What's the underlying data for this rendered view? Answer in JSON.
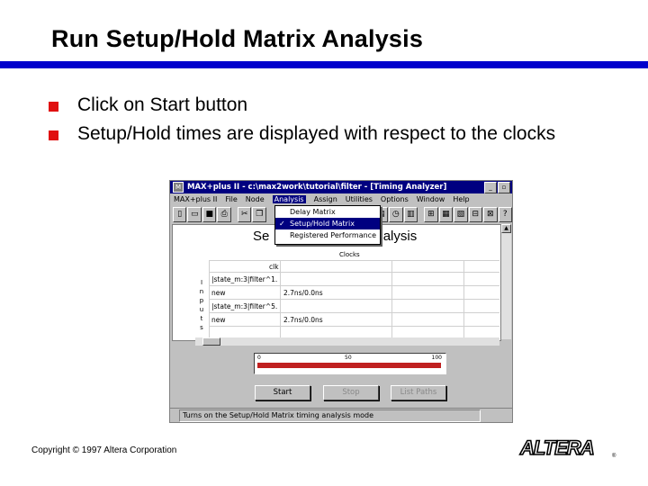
{
  "slide": {
    "title": "Run Setup/Hold Matrix Analysis",
    "bullets": [
      "Click on Start button",
      "Setup/Hold times are displayed with respect to the clocks"
    ],
    "copyright": "Copyright © 1997 Altera Corporation",
    "logo_text": "ALTERA"
  },
  "app": {
    "window_title": "MAX+plus II - c:\\max2work\\tutorial\\filter - [Timing Analyzer]",
    "menu": [
      "MAX+plus II",
      "File",
      "Node",
      "Analysis",
      "Assign",
      "Utilities",
      "Options",
      "Window",
      "Help"
    ],
    "active_menu": "Analysis",
    "analysis_menu": [
      {
        "label": "Delay Matrix",
        "checked": false
      },
      {
        "label": "Setup/Hold Matrix",
        "checked": true
      },
      {
        "label": "Registered Performance",
        "checked": false
      }
    ],
    "heading": "Setup/Hold Matrix Analysis",
    "heading_visible_left": "Se",
    "heading_visible_right": "Analysis",
    "clocks_label": "Clocks",
    "clock_column": "clk",
    "inputs_label": "Inputs",
    "rows": [
      {
        "input": "|state_m:3|filter^1.",
        "value": ""
      },
      {
        "input": "new",
        "value": "2.7ns/0.0ns"
      },
      {
        "input": "|state_m:3|filter^5.",
        "value": ""
      },
      {
        "input": "new",
        "value": "2.7ns/0.0ns"
      }
    ],
    "progress": {
      "min_label": "0",
      "mid_label": "50",
      "max_label": "100",
      "value_percent": 100
    },
    "buttons": {
      "start": "Start",
      "stop": "Stop",
      "list_paths": "List Paths"
    },
    "status_text": "Turns on the Setup/Hold Matrix timing analysis mode",
    "colors": {
      "titlebar": "#000080",
      "progress": "#c02020",
      "rule": "#0000cc",
      "bullet": "#e01010"
    }
  }
}
